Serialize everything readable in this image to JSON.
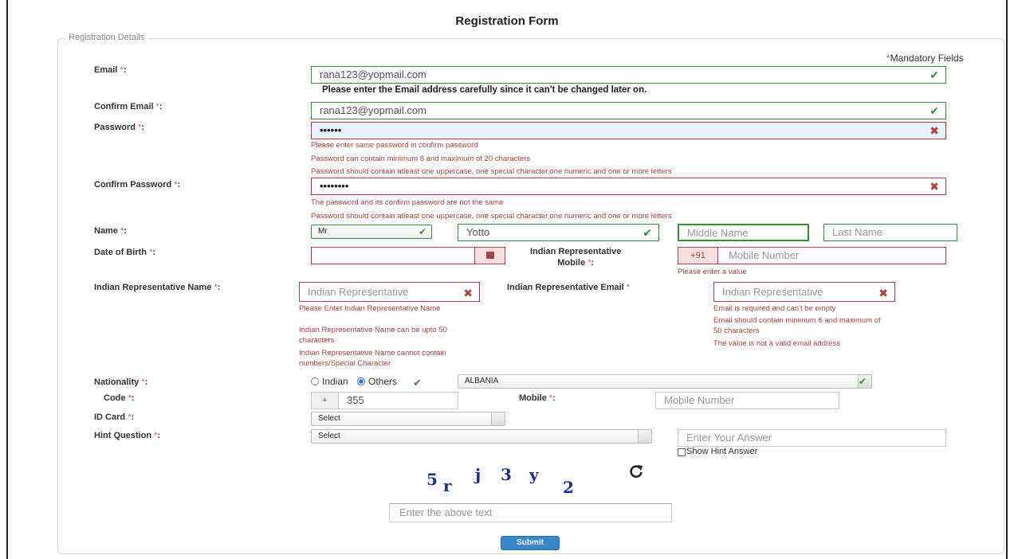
{
  "page": {
    "title": "Registration Form",
    "legend": "Registration Details",
    "mandatory_note": "Mandatory Fields",
    "asterisk": "*"
  },
  "email": {
    "label": "Email",
    "value": "rana123@yopmail.com",
    "hint": "Please enter the Email address carefully since it can't be changed later on."
  },
  "confirm_email": {
    "label": "Confirm Email",
    "value": "rana123@yopmail.com"
  },
  "password": {
    "label": "Password",
    "value": "••••••",
    "errors": [
      "Please enter same password in confirm password",
      "Password can contain minimum 8 and maximum of 20 characters",
      "Password should contain atleast one uppercase, one special character,one numeric and one or more letters"
    ]
  },
  "confirm_password": {
    "label": "Confirm Password",
    "value": "••••••••",
    "errors": [
      "The password and its confirm password are not the same",
      "Password should contain atleast one uppercase, one special character,one numeric and one or more letters"
    ]
  },
  "name": {
    "label": "Name",
    "title_value": "Mr",
    "first_value": "Yotto",
    "middle_placeholder": "Middle Name",
    "last_placeholder": "Last Name"
  },
  "dob": {
    "label": "Date of Birth",
    "value": ""
  },
  "rep_mobile": {
    "label_line1": "Indian Representative",
    "label_line2": "Mobile",
    "prefix": "+91",
    "placeholder": "Mobile Number",
    "error": "Please enter a value"
  },
  "rep_name": {
    "label": "Indian Representative Name",
    "placeholder": "Indian Representative",
    "errors": [
      "Please Enter Indian Representative Name",
      "Indian Representative Name can be upto 50 characters",
      "Indian Representative Name cannot contain numbers/Special Character"
    ]
  },
  "rep_email": {
    "label": "Indian Representative Email",
    "placeholder": "Indian Representative",
    "errors": [
      "Email is required and can't be empty",
      "Email should contain minimum 6 and maximum of 50 characters",
      "The value is not a valid email address"
    ]
  },
  "nationality": {
    "label": "Nationality",
    "option_indian": "Indian",
    "option_others": "Others",
    "selected": "Others",
    "country_value": "ALBANIA"
  },
  "code": {
    "label": "Code",
    "prefix": "+",
    "value": "355"
  },
  "mobile": {
    "label": "Mobile",
    "placeholder": "Mobile Number"
  },
  "id_card": {
    "label": "ID Card",
    "value": "Select"
  },
  "hint_question": {
    "label": "Hint Question",
    "value": "Select",
    "answer_placeholder": "Enter Your Answer",
    "show_hint_label": "Show Hint Answer"
  },
  "captcha": {
    "chars": [
      "5",
      "r",
      "j",
      "3",
      "y",
      "2"
    ],
    "input_placeholder": "Enter the above text",
    "refresh_icon": "refresh-icon"
  },
  "submit": {
    "label": "Submit"
  },
  "colors": {
    "success": "#3c8b3c",
    "error": "#a94442",
    "primary": "#3a87c8",
    "captcha": "#1a2f8f"
  }
}
